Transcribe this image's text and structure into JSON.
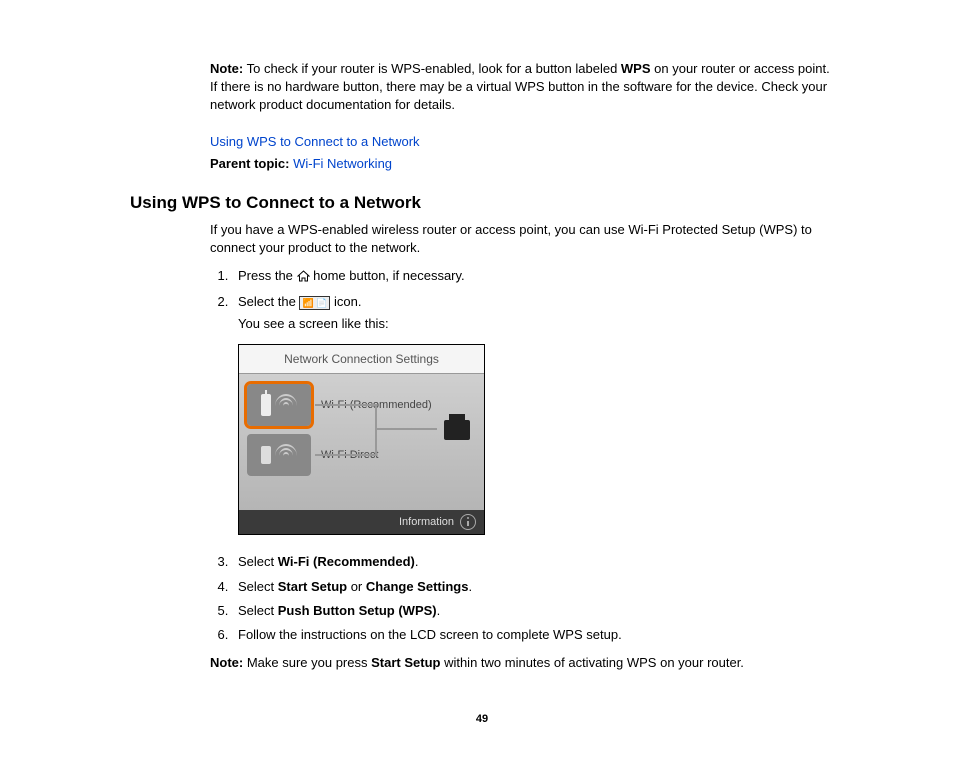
{
  "noteTop": {
    "label": "Note:",
    "textA": " To check if your router is WPS-enabled, look for a button labeled ",
    "wps": "WPS",
    "textB": " on your router or access point. If there is no hardware button, there may be a virtual WPS button in the software for the device. Check your network product documentation for details."
  },
  "links": {
    "wpsConnect": "Using WPS to Connect to a Network",
    "parentLabel": "Parent topic:",
    "parentLink": " Wi-Fi Networking"
  },
  "heading": "Using WPS to Connect to a Network",
  "intro": "If you have a WPS-enabled wireless router or access point, you can use Wi-Fi Protected Setup (WPS) to connect your product to the network.",
  "step1a": "Press the ",
  "step1b": " home button, if necessary.",
  "step2a": "Select the ",
  "step2b": " icon.",
  "step2c": "You see a screen like this:",
  "figure": {
    "title": "Network Connection Settings",
    "opt1": "Wi-Fi (Recommended)",
    "opt2": "Wi-Fi Direct",
    "footer": "Information"
  },
  "step3a": "Select ",
  "step3b": "Wi-Fi (Recommended)",
  "step3c": ".",
  "step4a": "Select ",
  "step4b": "Start Setup",
  "step4c": " or ",
  "step4d": "Change Settings",
  "step4e": ".",
  "step5a": "Select ",
  "step5b": "Push Button Setup (WPS)",
  "step5c": ".",
  "step6": "Follow the instructions on the LCD screen to complete WPS setup.",
  "noteBottom": {
    "label": "Note:",
    "a": " Make sure you press ",
    "b": "Start Setup",
    "c": " within two minutes of activating WPS on your router."
  },
  "pageNumber": "49"
}
